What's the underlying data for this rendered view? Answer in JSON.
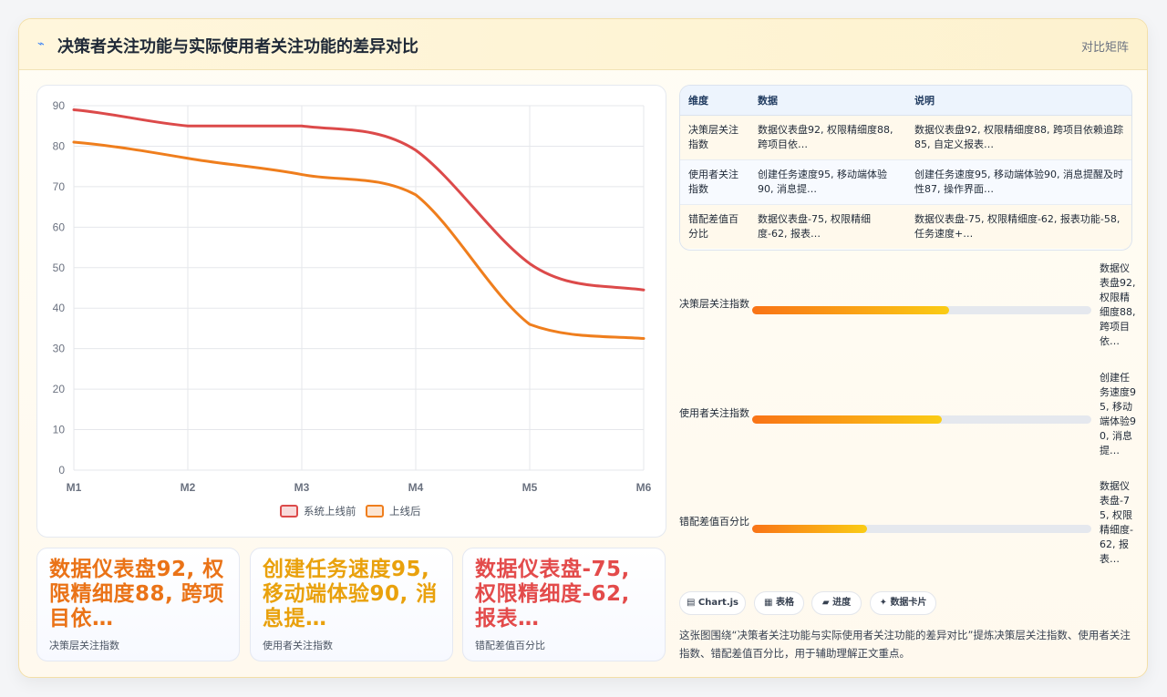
{
  "header": {
    "title": "决策者关注功能与实际使用者关注功能的差异对比",
    "tag": "对比矩阵",
    "icon": "lightning-icon"
  },
  "chart_data": {
    "type": "line",
    "x": [
      "M1",
      "M2",
      "M3",
      "M4",
      "M5",
      "M6"
    ],
    "series": [
      {
        "name": "系统上线前",
        "values": [
          89,
          85,
          85,
          79,
          51,
          44.5
        ],
        "color": "#dc4a4a"
      },
      {
        "name": "上线后",
        "values": [
          81,
          77,
          73,
          68,
          36,
          32.5
        ],
        "color": "#ef7e1d"
      }
    ],
    "ylim": [
      0,
      90
    ],
    "yticks": [
      "0",
      "10",
      "20",
      "30",
      "40",
      "50",
      "60",
      "70",
      "80",
      "90"
    ],
    "grid": true,
    "legend": "bottom"
  },
  "kpis": [
    {
      "value": "数据仪表盘92, 权限精细度88, 跨项目依…",
      "label": "决策层关注指数",
      "color": "#ea7317"
    },
    {
      "value": "创建任务速度95, 移动端体验90, 消息提…",
      "label": "使用者关注指数",
      "color": "#e9a10c"
    },
    {
      "value": "数据仪表盘-75, 权限精细度-62, 报表…",
      "label": "错配差值百分比",
      "color": "#e34b4b"
    }
  ],
  "table": {
    "headers": [
      "维度",
      "数据",
      "说明"
    ],
    "rows": [
      [
        "决策层关注指数",
        "数据仪表盘92, 权限精细度88, 跨项目依…",
        "数据仪表盘92, 权限精细度88, 跨项目依赖追踪85, 自定义报表…"
      ],
      [
        "使用者关注指数",
        "创建任务速度95, 移动端体验90, 消息提…",
        "创建任务速度95, 移动端体验90, 消息提醒及时性87, 操作界面…"
      ],
      [
        "错配差值百分比",
        "数据仪表盘-75, 权限精细度-62, 报表…",
        "数据仪表盘-75, 权限精细度-62, 报表功能-58, 任务速度+…"
      ]
    ]
  },
  "progress": [
    {
      "label": "决策层关注指数",
      "value": "数据仪表盘92, 权限精细度88, 跨项目依…",
      "fill": 0.58
    },
    {
      "label": "使用者关注指数",
      "value": "创建任务速度95, 移动端体验90, 消息提…",
      "fill": 0.56
    },
    {
      "label": "错配差值百分比",
      "value": "数据仪表盘-75, 权限精细度-62, 报表…",
      "fill": 0.34
    }
  ],
  "chips": [
    {
      "icon": "table-grid-icon",
      "glyph": "▤",
      "label": "Chart.js"
    },
    {
      "icon": "table-icon",
      "glyph": "▦",
      "label": "表格"
    },
    {
      "icon": "progress-icon",
      "glyph": "▰",
      "label": "进度"
    },
    {
      "icon": "sparkle-icon",
      "glyph": "✦",
      "label": "数据卡片"
    }
  ],
  "note": "这张图围绕“决策者关注功能与实际使用者关注功能的差异对比”提炼决策层关注指数、使用者关注指数、错配差值百分比，用于辅助理解正文重点。"
}
